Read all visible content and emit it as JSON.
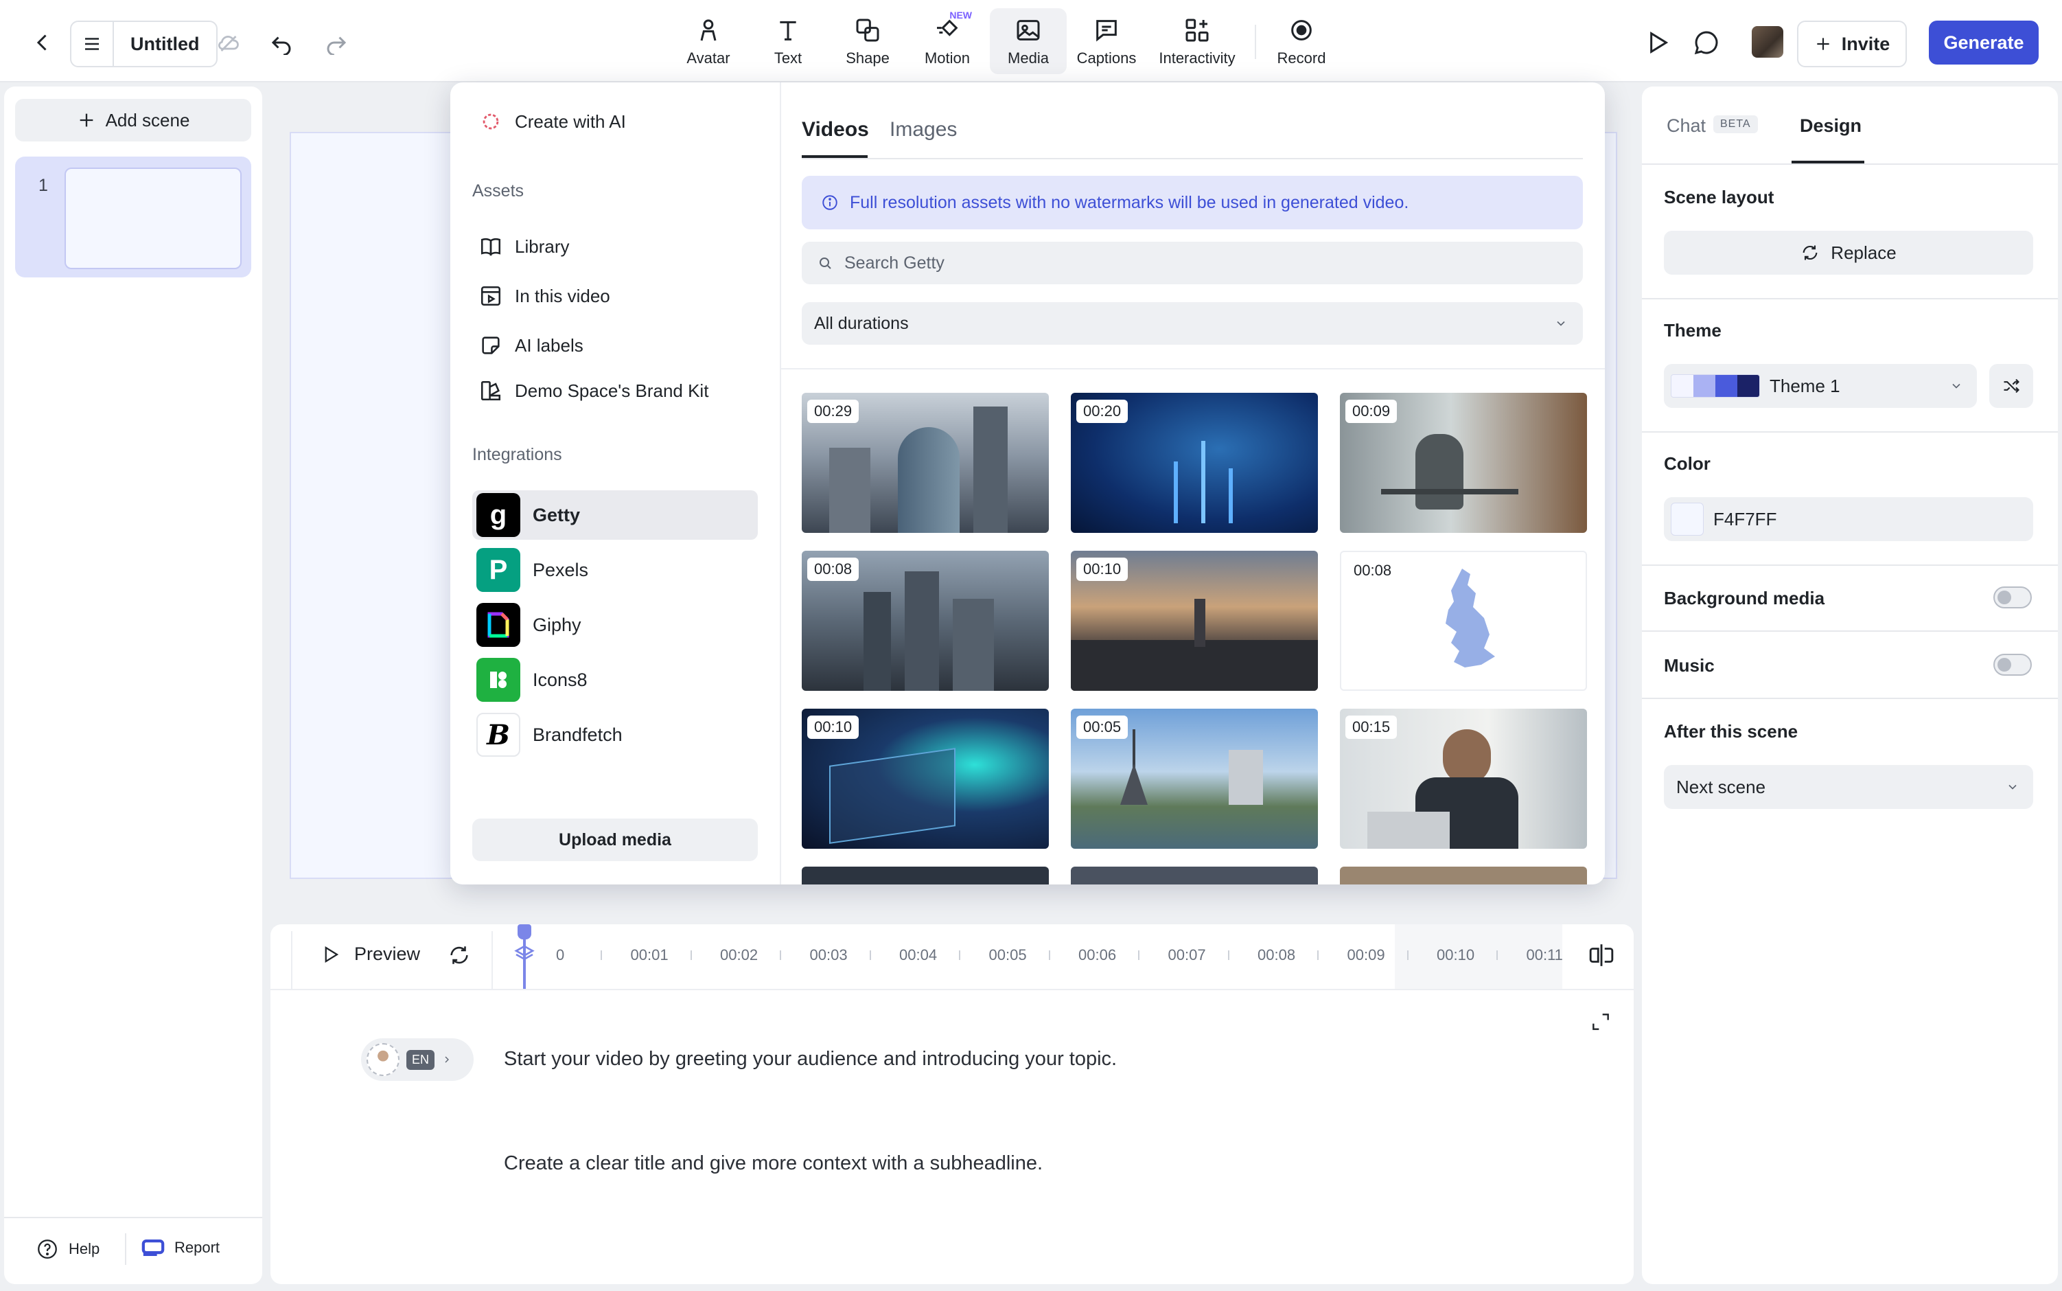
{
  "app": {
    "doc_title": "Untitled",
    "tools": [
      {
        "label": "Avatar",
        "icon": "avatar-icon"
      },
      {
        "label": "Text",
        "icon": "text-icon"
      },
      {
        "label": "Shape",
        "icon": "shape-icon"
      },
      {
        "label": "Motion",
        "icon": "motion-icon",
        "badge": "NEW"
      },
      {
        "label": "Media",
        "icon": "media-icon",
        "active": true
      },
      {
        "label": "Captions",
        "icon": "captions-icon"
      },
      {
        "label": "Interactivity",
        "icon": "interactivity-icon"
      },
      {
        "label": "Record",
        "icon": "record-icon"
      }
    ],
    "invite_label": "Invite",
    "generate_label": "Generate",
    "accent_color": "#3d4fd6"
  },
  "scenes": {
    "add_label": "Add scene",
    "items": [
      {
        "number": "1"
      }
    ]
  },
  "left_footer": {
    "help_label": "Help",
    "report_label": "Report"
  },
  "media": {
    "create_ai_label": "Create with AI",
    "assets_heading": "Assets",
    "assets": [
      "Library",
      "In this video",
      "AI labels",
      "Demo Space's Brand Kit"
    ],
    "integrations_heading": "Integrations",
    "integrations": [
      {
        "name": "Getty",
        "selected": true,
        "logo_letter": "g",
        "color": "#000000"
      },
      {
        "name": "Pexels",
        "logo_letter": "P",
        "color": "#05a081"
      },
      {
        "name": "Giphy",
        "logo_letter": "",
        "color": "#000000"
      },
      {
        "name": "Icons8",
        "logo_letter": "",
        "color": "#1fb141"
      },
      {
        "name": "Brandfetch",
        "logo_letter": "B",
        "color": "#ffffff"
      }
    ],
    "upload_label": "Upload media",
    "tabs": {
      "videos": "Videos",
      "images": "Images"
    },
    "info_text": "Full resolution assets with no watermarks will be used in generated video.",
    "search_placeholder": "Search Getty",
    "duration_filter": "All durations",
    "videos": [
      {
        "duration": "00:29"
      },
      {
        "duration": "00:20"
      },
      {
        "duration": "00:09"
      },
      {
        "duration": "00:08"
      },
      {
        "duration": "00:10"
      },
      {
        "duration": "00:08"
      },
      {
        "duration": "00:10"
      },
      {
        "duration": "00:05"
      },
      {
        "duration": "00:15"
      }
    ]
  },
  "timeline": {
    "preview_label": "Preview",
    "ticks": [
      "0",
      "00:01",
      "00:02",
      "00:03",
      "00:04",
      "00:05",
      "00:06",
      "00:07",
      "00:08",
      "00:09",
      "00:10",
      "00:11"
    ],
    "language": "EN",
    "script_lines": [
      "Start your video by greeting your audience and introducing your topic.",
      "Create a clear title and give more context with a subheadline."
    ]
  },
  "design_panel": {
    "tab_chat": "Chat",
    "tab_chat_badge": "BETA",
    "tab_design": "Design",
    "scene_layout_label": "Scene layout",
    "replace_label": "Replace",
    "theme_label": "Theme",
    "theme_value": "Theme 1",
    "theme_swatches": [
      "#f4f5ff",
      "#aab2f3",
      "#4a5bdc",
      "#1b2267"
    ],
    "color_label": "Color",
    "color_value": "F4F7FF",
    "background_media_label": "Background media",
    "background_media_on": false,
    "music_label": "Music",
    "music_on": false,
    "after_scene_label": "After this scene",
    "after_scene_value": "Next scene"
  }
}
